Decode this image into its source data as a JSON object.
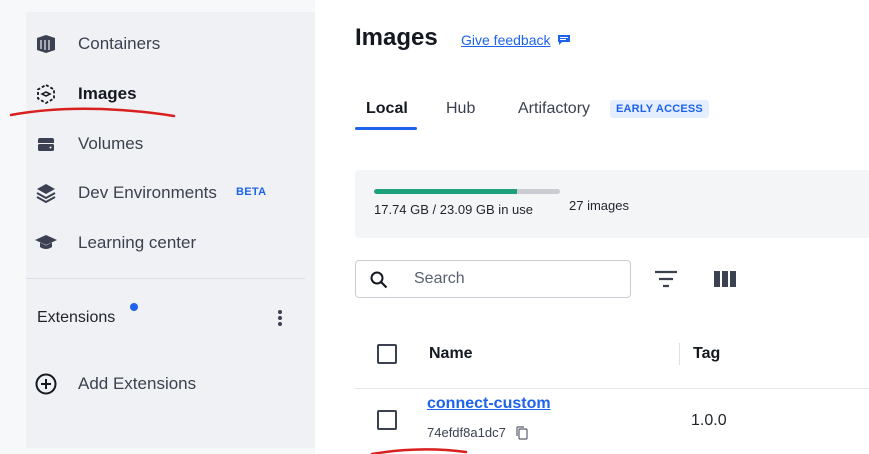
{
  "sidebar": {
    "items": [
      {
        "label": "Containers",
        "icon": "container-icon"
      },
      {
        "label": "Images",
        "icon": "image-icon",
        "active": true
      },
      {
        "label": "Volumes",
        "icon": "volume-icon"
      },
      {
        "label": "Dev Environments",
        "icon": "dev-env-icon",
        "badge": "BETA"
      },
      {
        "label": "Learning center",
        "icon": "graduation-cap-icon"
      }
    ],
    "extensions_label": "Extensions",
    "add_extensions_label": "Add Extensions"
  },
  "header": {
    "title": "Images",
    "feedback_link": "Give feedback"
  },
  "tabs": [
    {
      "label": "Local",
      "active": true
    },
    {
      "label": "Hub"
    },
    {
      "label": "Artifactory",
      "badge": "EARLY ACCESS"
    }
  ],
  "usage": {
    "text": "17.74 GB / 23.09 GB in use",
    "count": "27 images",
    "fraction": 0.768
  },
  "search": {
    "placeholder": "Search"
  },
  "table": {
    "columns": [
      "Name",
      "Tag"
    ],
    "rows": [
      {
        "name": "connect-custom",
        "id": "74efdf8a1dc7",
        "tag": "1.0.0"
      }
    ]
  },
  "colors": {
    "accent": "#1d63ed",
    "usage_fill": "#1fa07d",
    "annotation": "#d8201f"
  }
}
